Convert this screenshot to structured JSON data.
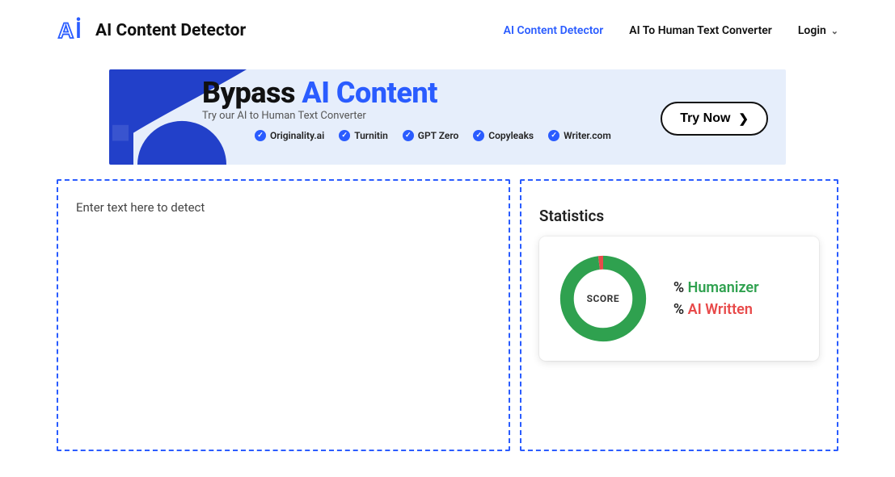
{
  "header": {
    "brand": "AI Content Detector",
    "nav": {
      "detector": "AI Content Detector",
      "converter": "AI To Human Text Converter",
      "login": "Login"
    }
  },
  "banner": {
    "headline_prefix": "Bypass ",
    "headline_accent": "AI Content",
    "subtitle": "Try our AI to Human Text Converter",
    "cta": "Try Now",
    "checks": [
      "Originality.ai",
      "Turnitin",
      "GPT Zero",
      "Copyleaks",
      "Writer.com"
    ]
  },
  "editor": {
    "placeholder": "Enter text here to detect",
    "value": ""
  },
  "stats": {
    "title": "Statistics",
    "score_label": "SCORE",
    "humanizer_pct": "",
    "ai_pct": "",
    "humanizer_label": "Humanizer",
    "ai_label": "AI Written",
    "pct_symbol": "%"
  },
  "chart_data": {
    "type": "pie",
    "title": "SCORE",
    "series": [
      {
        "name": "Humanizer",
        "value": 98,
        "color": "#2fa14f"
      },
      {
        "name": "AI Written",
        "value": 2,
        "color": "#e84a4a"
      }
    ]
  },
  "colors": {
    "accent": "#2a5cff",
    "green": "#2fa14f",
    "red": "#e84a4a"
  }
}
